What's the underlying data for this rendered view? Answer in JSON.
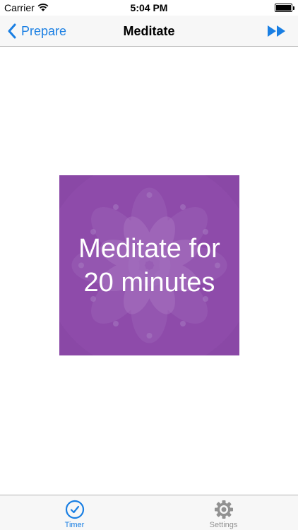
{
  "status_bar": {
    "carrier": "Carrier",
    "time": "5:04 PM",
    "battery_level": 1.0
  },
  "nav": {
    "back_label": "Prepare",
    "title": "Meditate",
    "back_icon": "chevron-left-icon",
    "forward_icon": "fast-forward-icon"
  },
  "card": {
    "text": "Meditate for 20 minutes",
    "background_color": "#8a48a6"
  },
  "tabs": [
    {
      "label": "Timer",
      "icon": "clock-icon",
      "active": true
    },
    {
      "label": "Settings",
      "icon": "gear-icon",
      "active": false
    }
  ],
  "colors": {
    "accent": "#1a7fe3",
    "inactive": "#929292",
    "bar_background": "#f7f7f7"
  }
}
